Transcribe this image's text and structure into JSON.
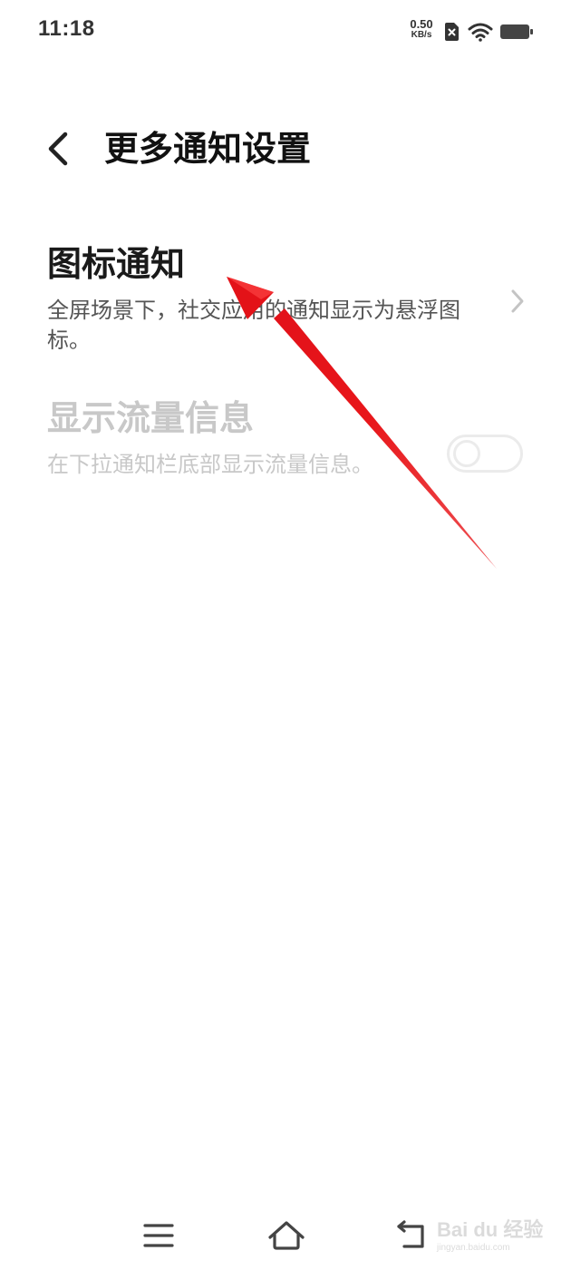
{
  "status_bar": {
    "time": "11:18",
    "net_speed_value": "0.50",
    "net_speed_unit": "KB/s"
  },
  "header": {
    "title": "更多通知设置"
  },
  "settings": {
    "icon_notification": {
      "title": "图标通知",
      "description": "全屏场景下，社交应用的通知显示为悬浮图标。"
    },
    "data_usage_info": {
      "title": "显示流量信息",
      "description": "在下拉通知栏底部显示流量信息。",
      "enabled": false,
      "disabled_state": true
    }
  },
  "icons": {
    "back": "chevron-left-icon",
    "chevron": "chevron-right-icon",
    "wifi": "wifi-icon",
    "battery": "battery-icon",
    "nav_menu": "menu-icon",
    "nav_home": "home-icon",
    "nav_back": "back-icon"
  },
  "watermark": {
    "text": "Bai du 经验",
    "sub": "jingyan.baidu.com"
  },
  "colors": {
    "annotation_arrow": "#e8161a",
    "disabled_text": "#c8c8c8"
  }
}
